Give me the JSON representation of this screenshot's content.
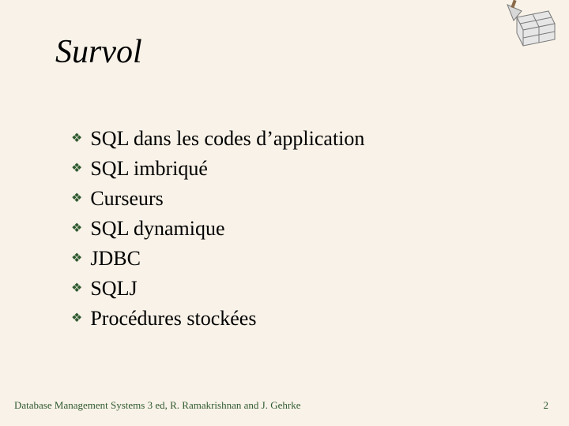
{
  "title": "Survol",
  "bullets": [
    "SQL dans les codes d’application",
    "SQL imbriqué",
    "Curseurs",
    "SQL dynamique",
    "JDBC",
    "SQLJ",
    "Procédures stockées"
  ],
  "footer": "Database Management Systems 3 ed, R. Ramakrishnan and J. Gehrke",
  "page_number": "2",
  "bullet_glyph": "❖",
  "deco_alt": "bricks-trowel-icon"
}
